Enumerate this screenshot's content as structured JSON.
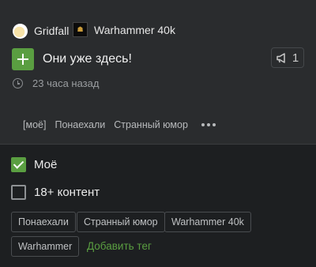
{
  "post": {
    "author": "Gridfall",
    "community": "Warhammer 40k",
    "title": "Они уже здесь!",
    "comments_count": "1",
    "time": "23 часа назад",
    "tags": [
      "[моё]",
      "Понаехали",
      "Странный юмор"
    ]
  },
  "editor": {
    "checkbox_mine": {
      "label": "Моё",
      "checked": true
    },
    "checkbox_adult": {
      "label": "18+ контент",
      "checked": false
    },
    "tag_chips": [
      "Понаехали",
      "Странный юмор",
      "Warhammer 40k",
      "Warhammer"
    ],
    "add_tag_label": "Добавить тег"
  },
  "colors": {
    "accent": "#5a9e41",
    "card_bg": "#2a2c2e",
    "page_bg": "#1d1f21"
  },
  "icons": {
    "plus": "plus-icon",
    "comments": "megaphone-icon",
    "time": "clock-icon",
    "more": "more-dots-icon"
  }
}
